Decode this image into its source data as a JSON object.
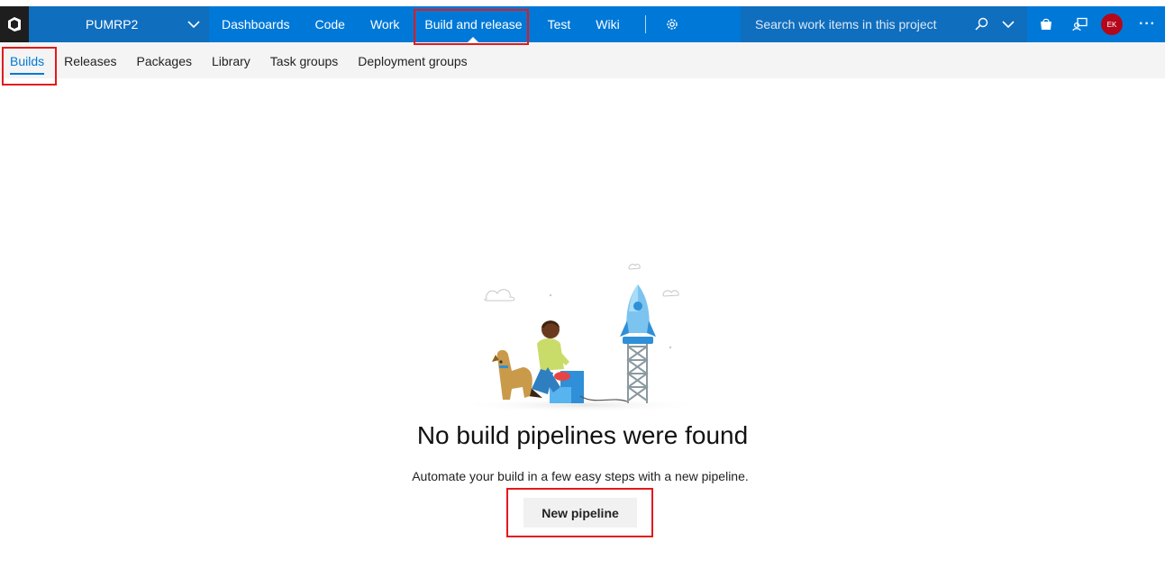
{
  "header": {
    "project_name": "PUMRP2",
    "nav_items": [
      "Dashboards",
      "Code",
      "Work",
      "Build and release",
      "Test",
      "Wiki"
    ],
    "active_nav": "Build and release",
    "search_placeholder": "Search work items in this project",
    "avatar_initials": "EK",
    "more_label": "···",
    "colors": {
      "bar": "#0078d7",
      "project_bg": "#106ebe",
      "avatar": "#b4071b"
    },
    "icons": [
      "vsts-logo-icon",
      "chevron-down-icon",
      "gear-icon",
      "search-icon",
      "chevron-down-icon",
      "marketplace-bag-icon",
      "feedback-icon",
      "more-icon"
    ]
  },
  "subnav": {
    "items": [
      "Builds",
      "Releases",
      "Packages",
      "Library",
      "Task groups",
      "Deployment groups"
    ],
    "active": "Builds"
  },
  "empty_state": {
    "title": "No build pipelines were found",
    "description": "Automate your build in a few easy steps with a new pipeline.",
    "button_label": "New pipeline"
  }
}
